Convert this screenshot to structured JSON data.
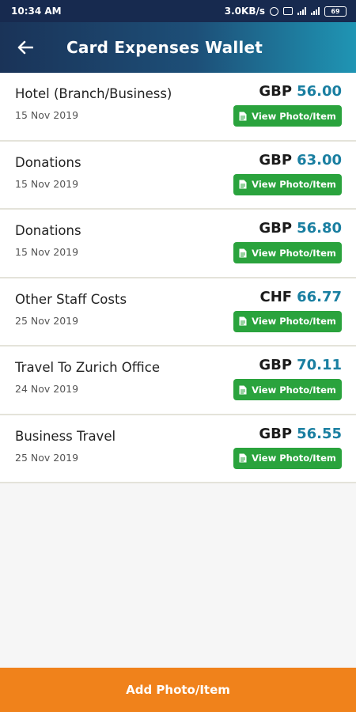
{
  "status_bar": {
    "time": "10:34 AM",
    "speed": "3.0KB/s",
    "battery": "69"
  },
  "header": {
    "back_icon": "arrow-left-icon",
    "title": "Card Expenses Wallet"
  },
  "expenses": [
    {
      "name": "Hotel (Branch/Business)",
      "date": "15 Nov 2019",
      "currency": "GBP",
      "amount": "56.00",
      "button": "View Photo/Item"
    },
    {
      "name": "Donations",
      "date": "15 Nov 2019",
      "currency": "GBP",
      "amount": "63.00",
      "button": "View Photo/Item"
    },
    {
      "name": "Donations",
      "date": "15 Nov 2019",
      "currency": "GBP",
      "amount": "56.80",
      "button": "View Photo/Item"
    },
    {
      "name": "Other Staff Costs",
      "date": "25 Nov 2019",
      "currency": "CHF",
      "amount": "66.77",
      "button": "View Photo/Item"
    },
    {
      "name": "Travel To Zurich Office",
      "date": "24 Nov 2019",
      "currency": "GBP",
      "amount": "70.11",
      "button": "View Photo/Item"
    },
    {
      "name": "Business Travel",
      "date": "25 Nov 2019",
      "currency": "GBP",
      "amount": "56.55",
      "button": "View Photo/Item"
    }
  ],
  "footer": {
    "add_label": "Add Photo/Item"
  },
  "colors": {
    "header_start": "#1a3358",
    "header_end": "#1f95b4",
    "amount": "#1a7fa1",
    "view_button": "#2aa33d",
    "footer_button": "#f0821b"
  }
}
